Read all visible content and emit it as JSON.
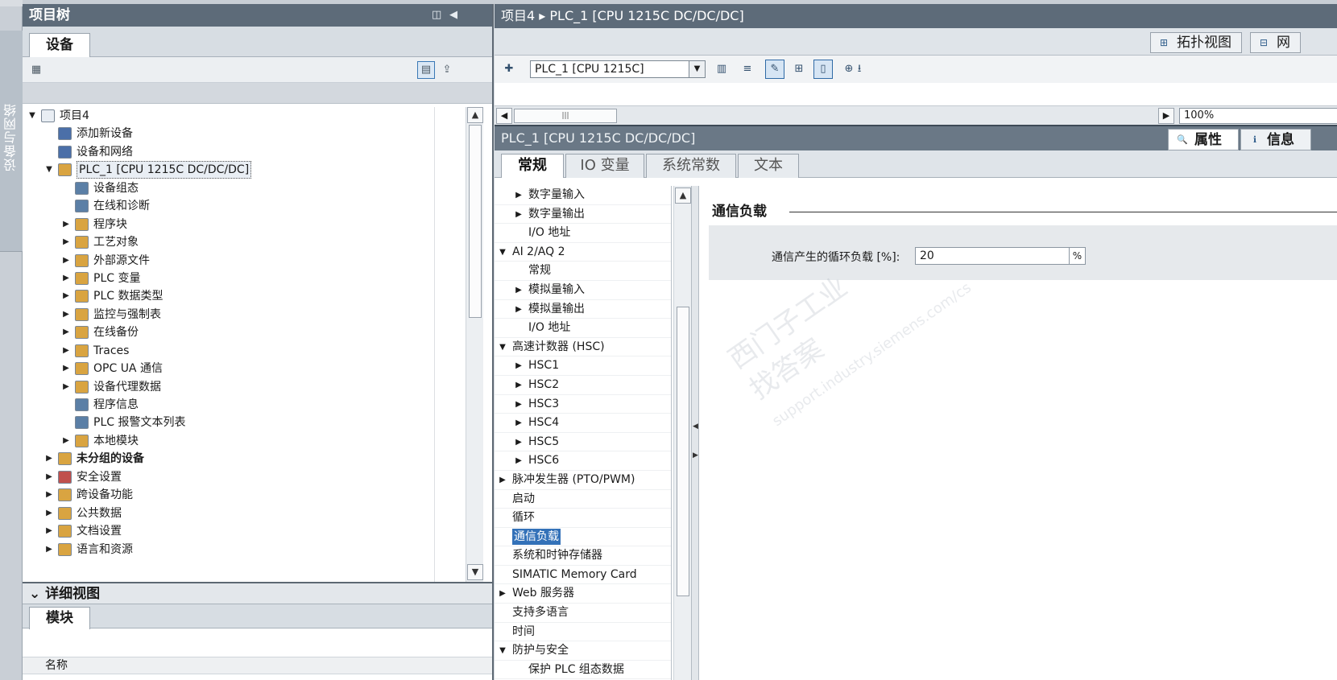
{
  "side_strip": {
    "label": "设备与网络"
  },
  "project_tree": {
    "title": "项目树",
    "tab": "设备",
    "items": [
      {
        "label": "项目4",
        "depth": 0,
        "expand": "open",
        "icon": "project-icon",
        "color": "#e9eef4",
        "bold": false,
        "selected": false
      },
      {
        "label": "添加新设备",
        "depth": 1,
        "expand": "none",
        "icon": "add-device-icon",
        "color": "#4b6fa8",
        "bold": false,
        "selected": false
      },
      {
        "label": "设备和网络",
        "depth": 1,
        "expand": "none",
        "icon": "network-icon",
        "color": "#4b6fa8",
        "bold": false,
        "selected": false
      },
      {
        "label": "PLC_1 [CPU 1215C DC/DC/DC]",
        "depth": 1,
        "expand": "open",
        "icon": "plc-icon",
        "color": "#d9a441",
        "bold": false,
        "selected": true
      },
      {
        "label": "设备组态",
        "depth": 2,
        "expand": "none",
        "icon": "device-config-icon",
        "color": "#5b7fa6",
        "bold": false,
        "selected": false
      },
      {
        "label": "在线和诊断",
        "depth": 2,
        "expand": "none",
        "icon": "diagnostics-icon",
        "color": "#5b7fa6",
        "bold": false,
        "selected": false
      },
      {
        "label": "程序块",
        "depth": 2,
        "expand": "closed",
        "icon": "folder-icon",
        "color": "#d9a441",
        "bold": false,
        "selected": false
      },
      {
        "label": "工艺对象",
        "depth": 2,
        "expand": "closed",
        "icon": "folder-icon",
        "color": "#d9a441",
        "bold": false,
        "selected": false
      },
      {
        "label": "外部源文件",
        "depth": 2,
        "expand": "closed",
        "icon": "folder-icon",
        "color": "#d9a441",
        "bold": false,
        "selected": false
      },
      {
        "label": "PLC 变量",
        "depth": 2,
        "expand": "closed",
        "icon": "folder-icon",
        "color": "#d9a441",
        "bold": false,
        "selected": false
      },
      {
        "label": "PLC 数据类型",
        "depth": 2,
        "expand": "closed",
        "icon": "folder-icon",
        "color": "#d9a441",
        "bold": false,
        "selected": false
      },
      {
        "label": "监控与强制表",
        "depth": 2,
        "expand": "closed",
        "icon": "folder-icon",
        "color": "#d9a441",
        "bold": false,
        "selected": false
      },
      {
        "label": "在线备份",
        "depth": 2,
        "expand": "closed",
        "icon": "folder-icon",
        "color": "#d9a441",
        "bold": false,
        "selected": false
      },
      {
        "label": "Traces",
        "depth": 2,
        "expand": "closed",
        "icon": "folder-icon",
        "color": "#d9a441",
        "bold": false,
        "selected": false
      },
      {
        "label": "OPC UA 通信",
        "depth": 2,
        "expand": "closed",
        "icon": "folder-icon",
        "color": "#d9a441",
        "bold": false,
        "selected": false
      },
      {
        "label": "设备代理数据",
        "depth": 2,
        "expand": "closed",
        "icon": "folder-icon",
        "color": "#d9a441",
        "bold": false,
        "selected": false
      },
      {
        "label": "程序信息",
        "depth": 2,
        "expand": "none",
        "icon": "program-info-icon",
        "color": "#5b7fa6",
        "bold": false,
        "selected": false
      },
      {
        "label": "PLC 报警文本列表",
        "depth": 2,
        "expand": "none",
        "icon": "text-list-icon",
        "color": "#5b7fa6",
        "bold": false,
        "selected": false
      },
      {
        "label": "本地模块",
        "depth": 2,
        "expand": "closed",
        "icon": "folder-icon",
        "color": "#d9a441",
        "bold": false,
        "selected": false
      },
      {
        "label": "未分组的设备",
        "depth": 1,
        "expand": "closed",
        "icon": "folder-icon",
        "color": "#d9a441",
        "bold": true,
        "selected": false
      },
      {
        "label": "安全设置",
        "depth": 1,
        "expand": "closed",
        "icon": "security-icon",
        "color": "#c0504d",
        "bold": false,
        "selected": false
      },
      {
        "label": "跨设备功能",
        "depth": 1,
        "expand": "closed",
        "icon": "folder-icon",
        "color": "#d9a441",
        "bold": false,
        "selected": false
      },
      {
        "label": "公共数据",
        "depth": 1,
        "expand": "closed",
        "icon": "folder-icon",
        "color": "#d9a441",
        "bold": false,
        "selected": false
      },
      {
        "label": "文档设置",
        "depth": 1,
        "expand": "closed",
        "icon": "folder-icon",
        "color": "#d9a441",
        "bold": false,
        "selected": false
      },
      {
        "label": "语言和资源",
        "depth": 1,
        "expand": "closed",
        "icon": "folder-icon",
        "color": "#d9a441",
        "bold": false,
        "selected": false
      }
    ]
  },
  "details_view": {
    "title": "详细视图",
    "tab": "模块",
    "column_name": "名称"
  },
  "editor": {
    "breadcrumb": "项目4 ▸ PLC_1 [CPU 1215C DC/DC/DC]",
    "topology_button": "拓扑视图",
    "network_button": "网",
    "device_select": "PLC_1 [CPU 1215C]",
    "zoom": "100%"
  },
  "inspector": {
    "title": "PLC_1 [CPU 1215C DC/DC/DC]",
    "properties_button": "属性",
    "info_button": "信息",
    "tabs": [
      "常规",
      "IO 变量",
      "系统常数",
      "文本"
    ],
    "nav": [
      {
        "label": "数字量输入",
        "depth": 1,
        "expand": "closed",
        "selected": false
      },
      {
        "label": "数字量输出",
        "depth": 1,
        "expand": "closed",
        "selected": false
      },
      {
        "label": "I/O 地址",
        "depth": 1,
        "expand": "none",
        "selected": false
      },
      {
        "label": "AI 2/AQ 2",
        "depth": 0,
        "expand": "open",
        "selected": false
      },
      {
        "label": "常规",
        "depth": 1,
        "expand": "none",
        "selected": false
      },
      {
        "label": "模拟量输入",
        "depth": 1,
        "expand": "closed",
        "selected": false
      },
      {
        "label": "模拟量输出",
        "depth": 1,
        "expand": "closed",
        "selected": false
      },
      {
        "label": "I/O 地址",
        "depth": 1,
        "expand": "none",
        "selected": false
      },
      {
        "label": "高速计数器 (HSC)",
        "depth": 0,
        "expand": "open",
        "selected": false
      },
      {
        "label": "HSC1",
        "depth": 1,
        "expand": "closed",
        "selected": false
      },
      {
        "label": "HSC2",
        "depth": 1,
        "expand": "closed",
        "selected": false
      },
      {
        "label": "HSC3",
        "depth": 1,
        "expand": "closed",
        "selected": false
      },
      {
        "label": "HSC4",
        "depth": 1,
        "expand": "closed",
        "selected": false
      },
      {
        "label": "HSC5",
        "depth": 1,
        "expand": "closed",
        "selected": false
      },
      {
        "label": "HSC6",
        "depth": 1,
        "expand": "closed",
        "selected": false
      },
      {
        "label": "脉冲发生器 (PTO/PWM)",
        "depth": 0,
        "expand": "closed",
        "selected": false
      },
      {
        "label": "启动",
        "depth": 0,
        "expand": "none",
        "selected": false
      },
      {
        "label": "循环",
        "depth": 0,
        "expand": "none",
        "selected": false
      },
      {
        "label": "通信负载",
        "depth": 0,
        "expand": "none",
        "selected": true
      },
      {
        "label": "系统和时钟存储器",
        "depth": 0,
        "expand": "none",
        "selected": false
      },
      {
        "label": "SIMATIC Memory Card",
        "depth": 0,
        "expand": "none",
        "selected": false
      },
      {
        "label": "Web 服务器",
        "depth": 0,
        "expand": "closed",
        "selected": false
      },
      {
        "label": "支持多语言",
        "depth": 0,
        "expand": "none",
        "selected": false
      },
      {
        "label": "时间",
        "depth": 0,
        "expand": "none",
        "selected": false
      },
      {
        "label": "防护与安全",
        "depth": 0,
        "expand": "open",
        "selected": false
      },
      {
        "label": "保护 PLC 组态数据",
        "depth": 1,
        "expand": "none",
        "selected": false
      }
    ],
    "section_title": "通信负载",
    "field_label": "通信产生的循环负载 [%]:",
    "field_value": "20",
    "field_unit": "%",
    "watermark": [
      "西门子工业",
      "找答案",
      "support.industry.siemens.com/cs"
    ]
  }
}
